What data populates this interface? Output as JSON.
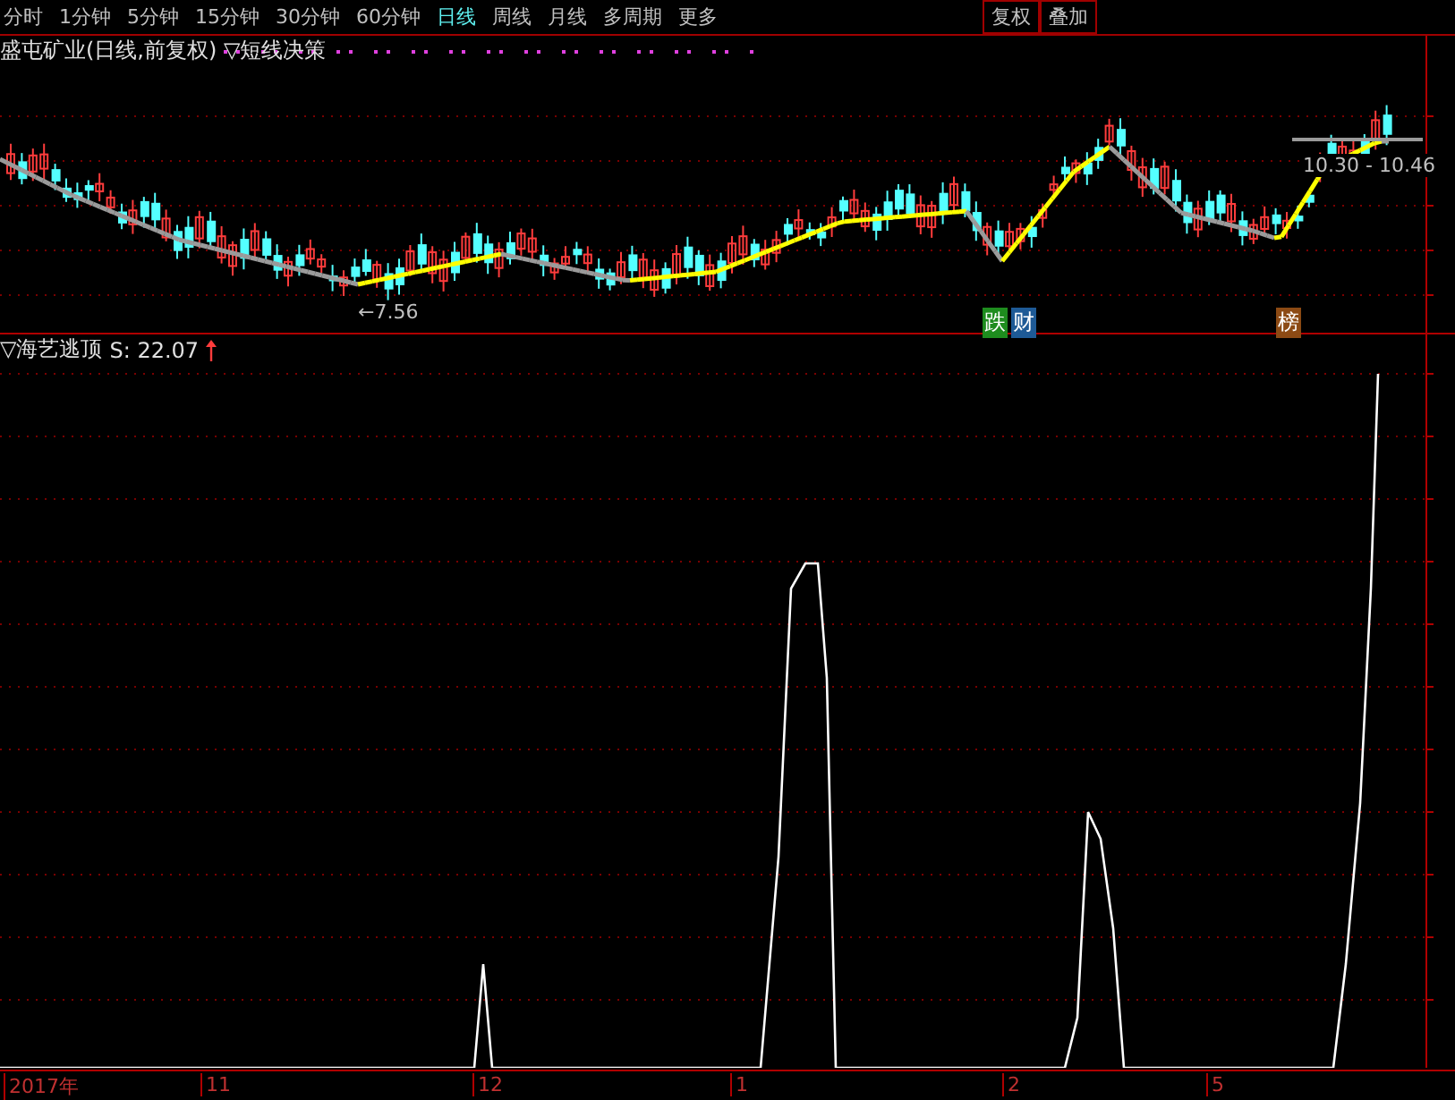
{
  "toolbar": {
    "periods": [
      {
        "label": "分时",
        "selected": false
      },
      {
        "label": "1分钟",
        "selected": false
      },
      {
        "label": "5分钟",
        "selected": false
      },
      {
        "label": "15分钟",
        "selected": false
      },
      {
        "label": "30分钟",
        "selected": false
      },
      {
        "label": "60分钟",
        "selected": false
      },
      {
        "label": "日线",
        "selected": true
      },
      {
        "label": "周线",
        "selected": false
      },
      {
        "label": "月线",
        "selected": false
      },
      {
        "label": "多周期",
        "selected": false
      },
      {
        "label": "更多",
        "selected": false
      }
    ],
    "buttons": [
      "复权",
      "叠加"
    ]
  },
  "price_pane": {
    "title": "盛屯矿业(日线,前复权) ▽短线决策",
    "low_label": "←7.56",
    "range_label": "10.30 - 10.46",
    "badges": [
      {
        "text": "跌",
        "color": "#1e8c1e"
      },
      {
        "text": "财",
        "color": "#1e5a96"
      },
      {
        "text": "榜",
        "color": "#8c4a14"
      }
    ]
  },
  "indicator_pane": {
    "name": "▽海艺逃顶",
    "reading": "S: 22.07"
  },
  "x_axis": {
    "labels": [
      "2017年",
      "11",
      "12",
      "1",
      "2",
      "5"
    ]
  }
}
